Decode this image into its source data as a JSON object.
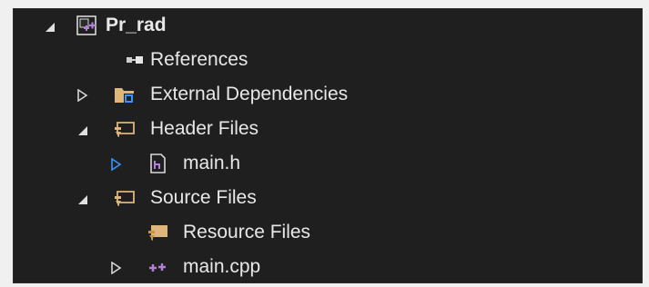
{
  "solution_explorer": {
    "project": {
      "name": "Pr_rad",
      "expanded": true,
      "icon": "cpp-project-icon",
      "children": [
        {
          "label": "References",
          "icon": "references-icon",
          "expandable": false
        },
        {
          "label": "External Dependencies",
          "icon": "external-dependencies-folder-icon",
          "expandable": true,
          "expanded": false
        },
        {
          "label": "Header Files",
          "icon": "filter-folder-icon",
          "expandable": true,
          "expanded": true,
          "children": [
            {
              "label": "main.h",
              "icon": "header-file-icon",
              "expandable": true,
              "expanded": false
            }
          ]
        },
        {
          "label": "Source Files",
          "icon": "filter-folder-icon",
          "expandable": true,
          "expanded": true,
          "children": [
            {
              "label": "Resource Files",
              "icon": "filter-folder-icon",
              "expandable": false
            },
            {
              "label": "main.cpp",
              "icon": "cpp-file-icon",
              "expandable": true,
              "expanded": false
            }
          ]
        }
      ]
    }
  },
  "colors": {
    "background": "#1f1f1f",
    "text": "#e8e8e8",
    "folder": "#dcb67a",
    "folder_dark": "#c39545",
    "blue_accent": "#3794ff",
    "cpp_purple": "#b180d7",
    "chevron": "#d4d4d4"
  }
}
